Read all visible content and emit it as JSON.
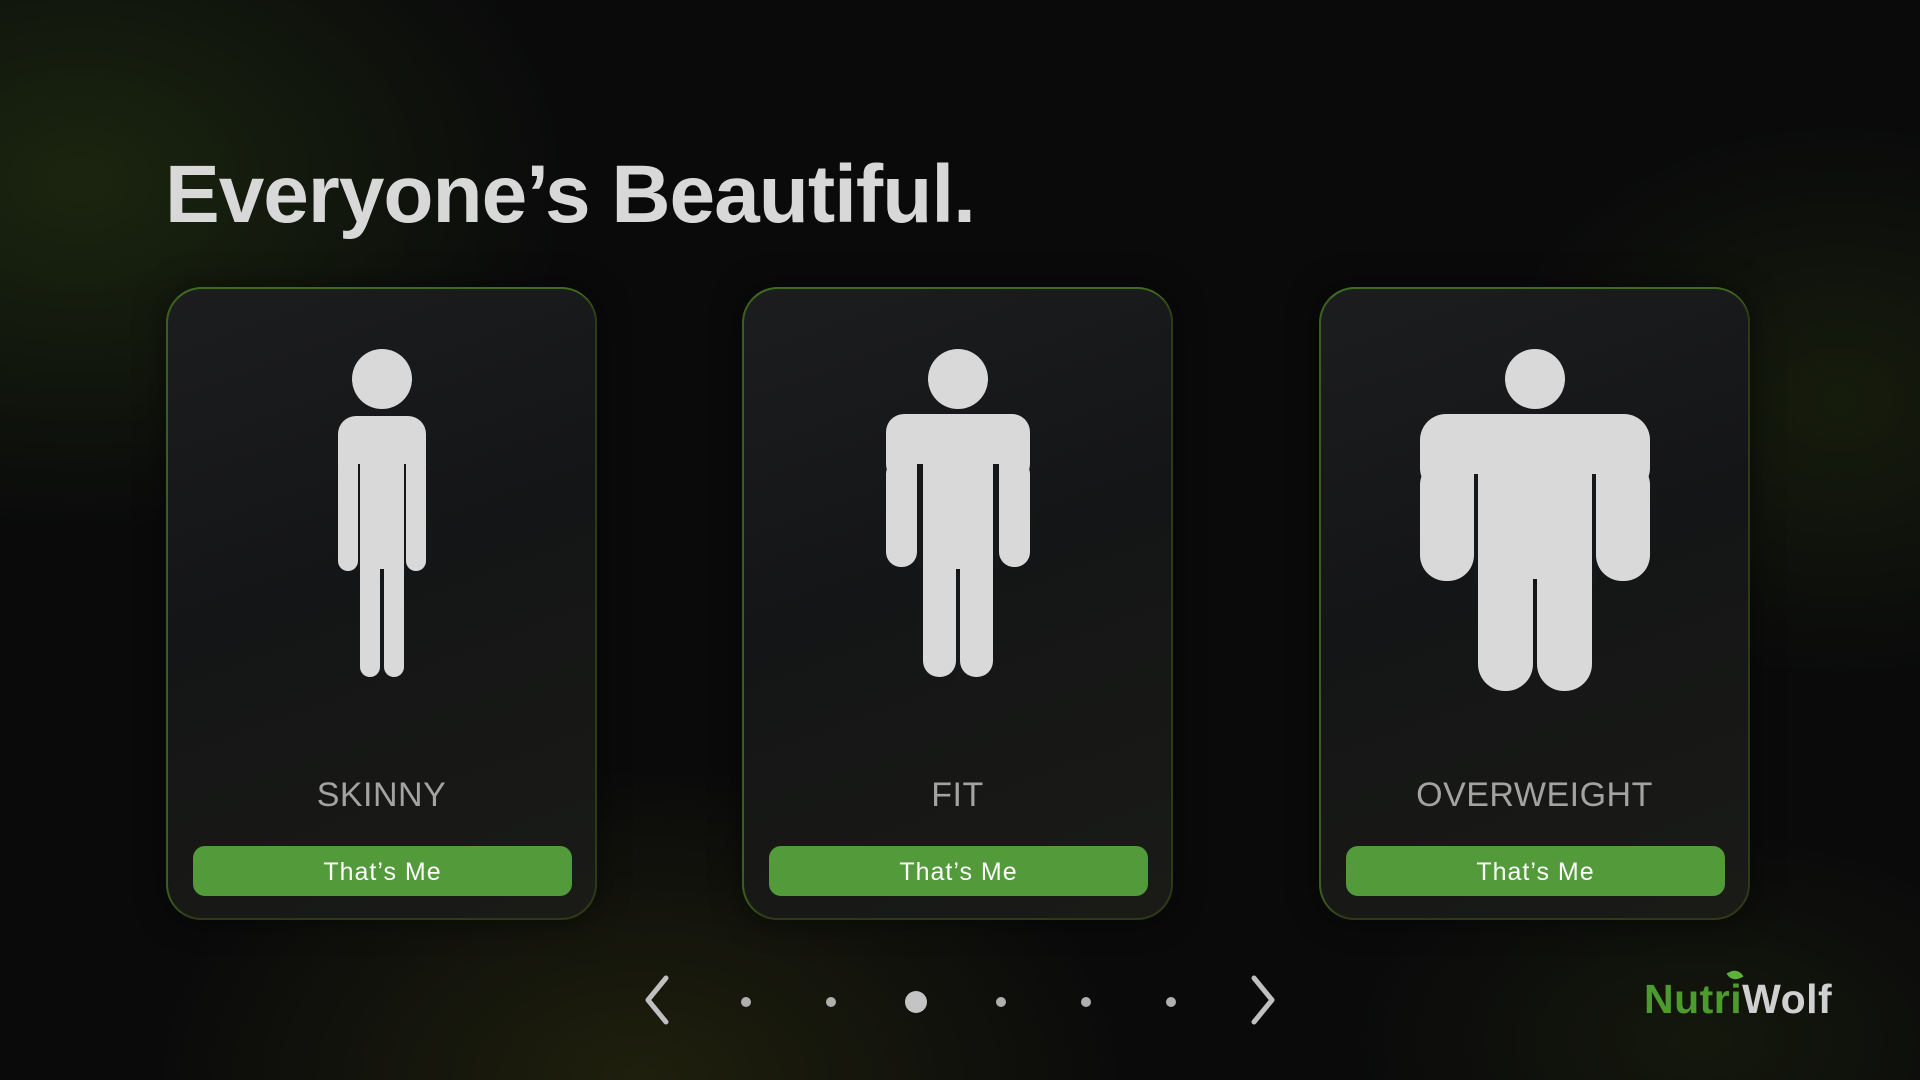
{
  "headline": "Everyone’s Beautiful.",
  "cards": [
    {
      "label": "SKINNY",
      "button": "That’s Me",
      "figure": "skinny-body-icon"
    },
    {
      "label": "FIT",
      "button": "That’s Me",
      "figure": "fit-body-icon"
    },
    {
      "label": "OVERWEIGHT",
      "button": "That’s Me",
      "figure": "overweight-body-icon"
    }
  ],
  "pager": {
    "total": 6,
    "active_index": 2,
    "prev_icon": "chevron-left-icon",
    "next_icon": "chevron-right-icon"
  },
  "brand": {
    "part1": "Nutri",
    "part2": "Wolf"
  },
  "colors": {
    "accent": "#529a3a",
    "brand_green": "#4d9b2f",
    "figure": "#d9d9d9",
    "text": "#d8d8d8",
    "label": "#a3a3a3",
    "card_border": "#2c3a16",
    "background": "#0a0a0b"
  }
}
